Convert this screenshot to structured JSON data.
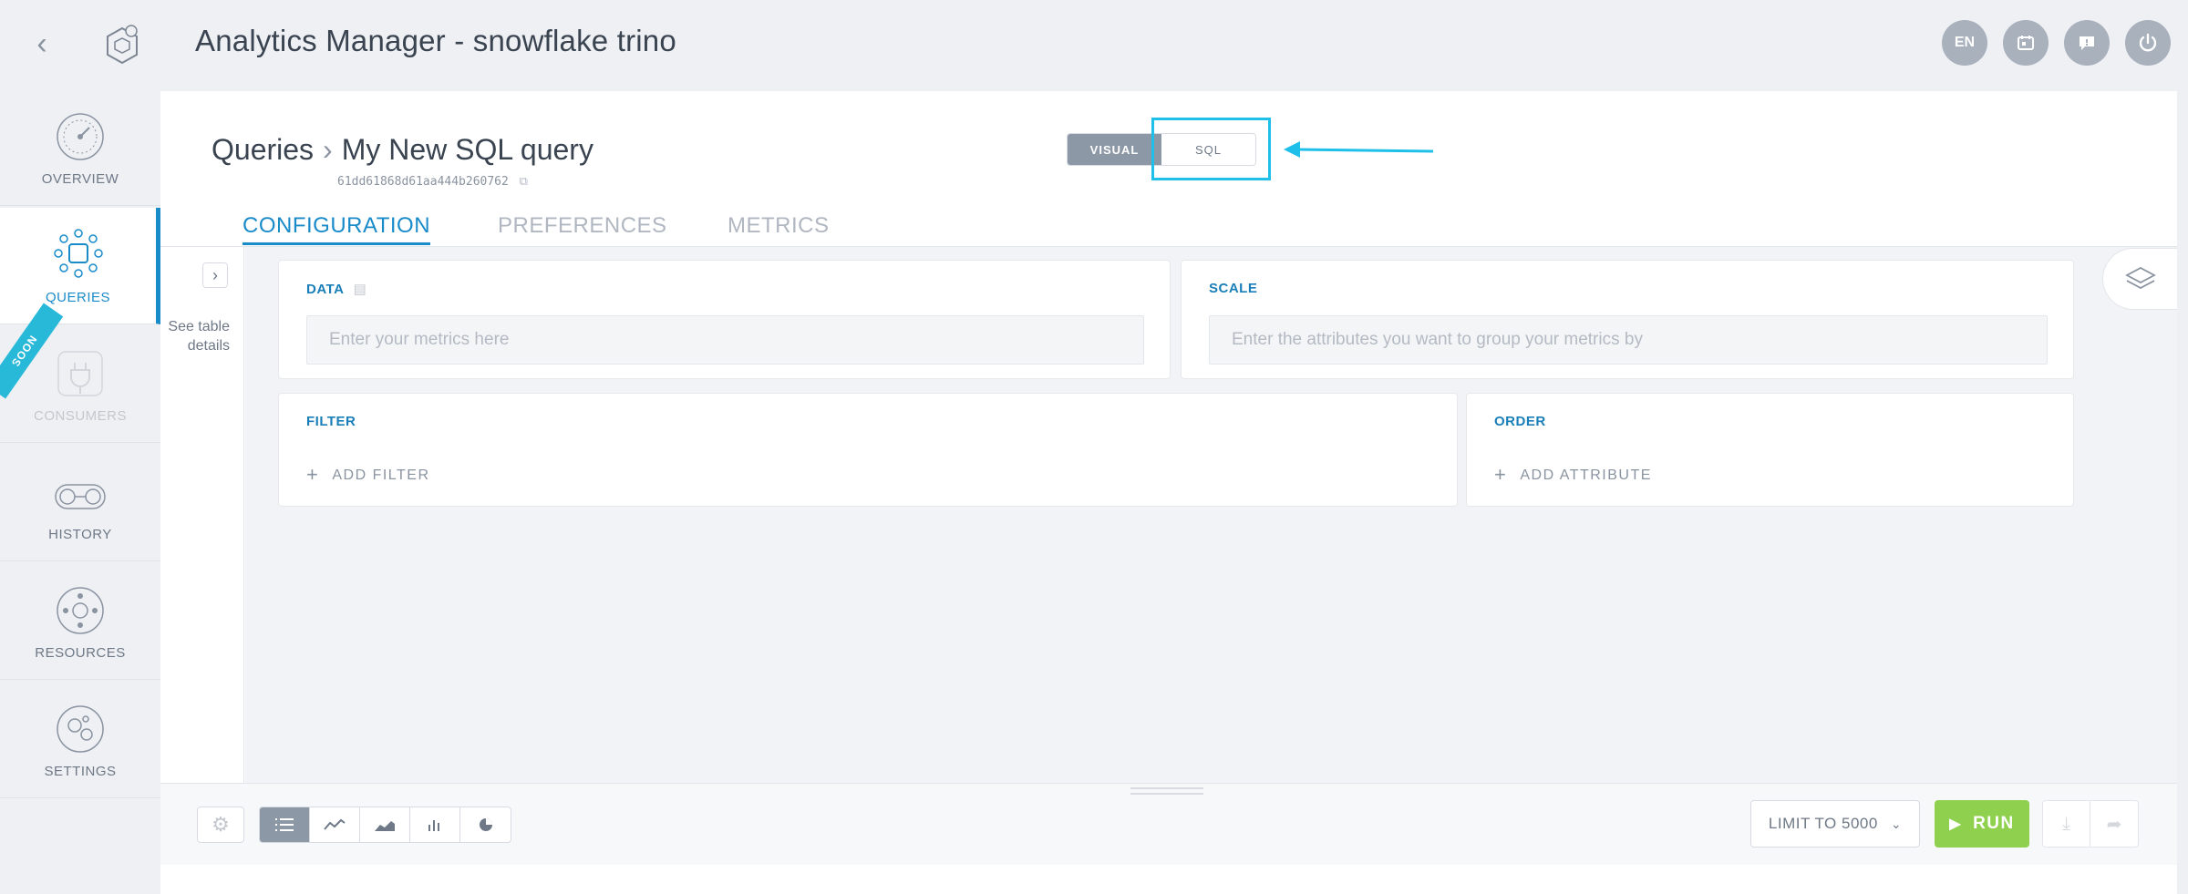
{
  "app": {
    "title": "Analytics Manager - snowflake trino",
    "top_icons": [
      {
        "name": "language-button",
        "label": "EN"
      },
      {
        "name": "calendar-icon"
      },
      {
        "name": "chat-icon"
      },
      {
        "name": "power-icon"
      }
    ]
  },
  "sidebar": {
    "items": [
      {
        "label": "OVERVIEW",
        "icon": "gauge-icon",
        "state": "normal"
      },
      {
        "label": "QUERIES",
        "icon": "queries-icon",
        "state": "active"
      },
      {
        "label": "CONSUMERS",
        "icon": "plug-icon",
        "state": "disabled",
        "badge": "SOON"
      },
      {
        "label": "HISTORY",
        "icon": "history-icon",
        "state": "normal"
      },
      {
        "label": "RESOURCES",
        "icon": "resources-icon",
        "state": "normal"
      },
      {
        "label": "SETTINGS",
        "icon": "settings-icon",
        "state": "normal"
      }
    ]
  },
  "header": {
    "breadcrumb_root": "Queries",
    "query_name": "My New SQL query",
    "query_id": "61dd61868d61aa444b260762",
    "mode_toggle": {
      "visual": "VISUAL",
      "sql": "SQL",
      "selected": "VISUAL"
    }
  },
  "tabs": [
    {
      "label": "CONFIGURATION",
      "active": true
    },
    {
      "label": "PREFERENCES",
      "active": false
    },
    {
      "label": "METRICS",
      "active": false
    }
  ],
  "details": {
    "label_line1": "See table",
    "label_line2": "details"
  },
  "cards": {
    "data": {
      "title": "DATA",
      "placeholder": "Enter your metrics here"
    },
    "scale": {
      "title": "SCALE",
      "placeholder": "Enter the attributes you want to group your metrics by"
    },
    "filter": {
      "title": "FILTER",
      "action": "ADD FILTER"
    },
    "order": {
      "title": "ORDER",
      "action": "ADD ATTRIBUTE"
    }
  },
  "bottom": {
    "limit_label": "LIMIT TO 5000",
    "run_label": "RUN",
    "viz_types": [
      "table-view-icon",
      "line-chart-icon",
      "area-chart-icon",
      "bar-chart-icon",
      "pie-chart-icon"
    ]
  },
  "colors": {
    "accent": "#1a8bc9",
    "highlight": "#1ec0ea",
    "run": "#8fd14f",
    "toggle_on": "#8d98a6"
  }
}
